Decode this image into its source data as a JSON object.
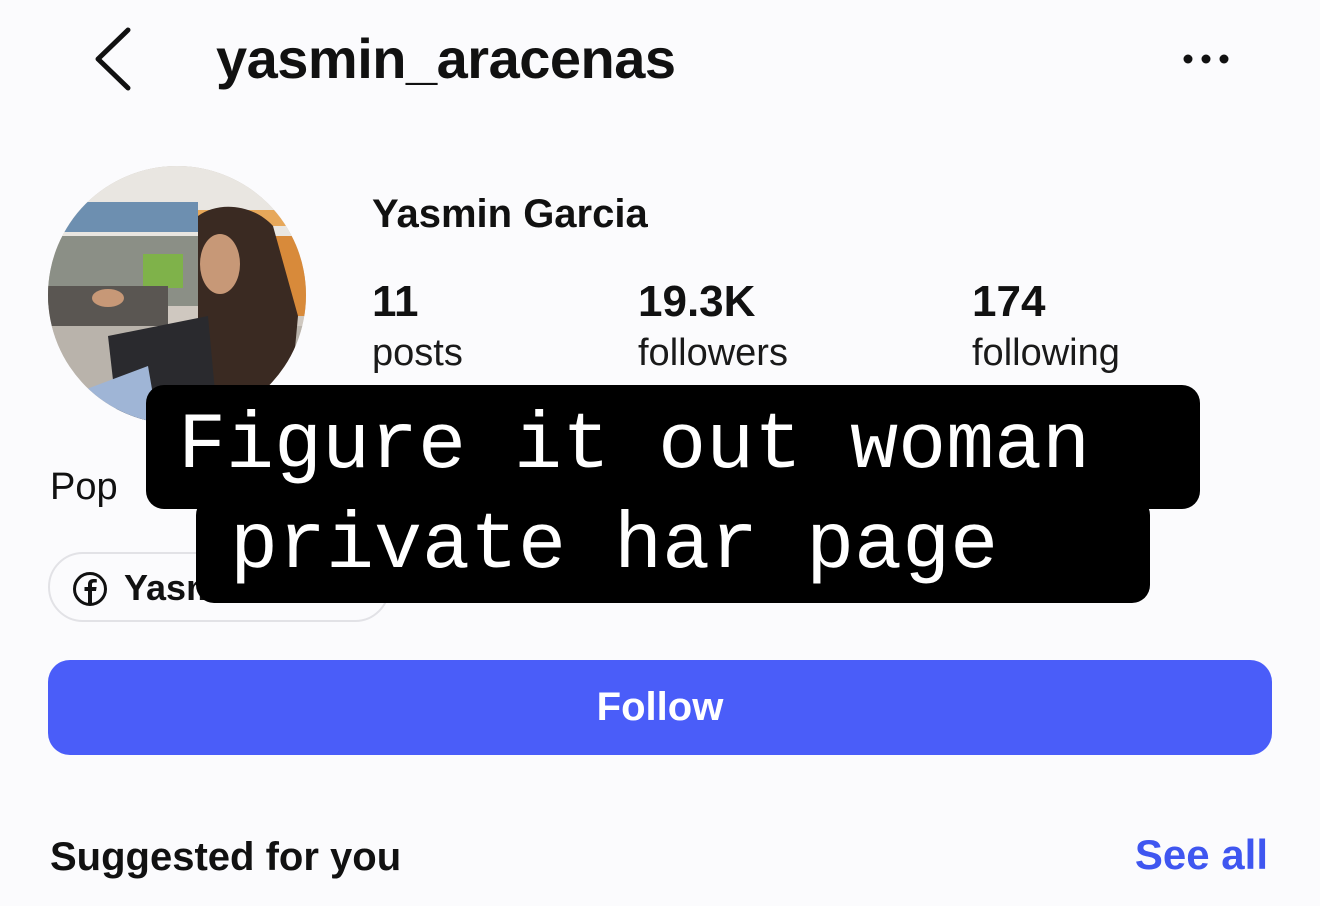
{
  "header": {
    "back_icon": "chevron-left-icon",
    "username": "yasmin_aracenas",
    "more_icon": "more-horizontal-icon"
  },
  "profile": {
    "display_name": "Yasmin Garcia",
    "stats": {
      "posts_value": "11",
      "posts_label": "posts",
      "followers_value": "19.3K",
      "followers_label": "followers",
      "following_value": "174",
      "following_label": "following"
    },
    "bio_partial": "Pop",
    "link_chip": {
      "icon": "facebook-icon",
      "label_partial": "Yasm"
    }
  },
  "caption_overlay": {
    "line1": "Figure it out woman",
    "line2": "private har page "
  },
  "actions": {
    "follow_label": "Follow"
  },
  "suggested": {
    "title": "Suggested for you",
    "see_all_label": "See all"
  },
  "colors": {
    "background": "#fbfbfd",
    "follow_button": "#4a5df9",
    "link_accent": "#3f56f0",
    "caption_bg": "#000000",
    "caption_text": "#ffffff"
  }
}
